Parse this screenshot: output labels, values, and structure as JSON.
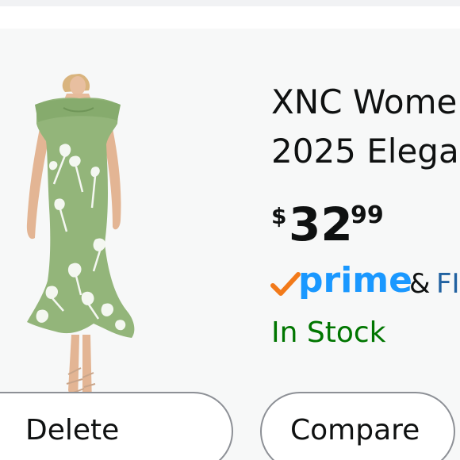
{
  "product": {
    "title_line1": "XNC Women",
    "title_line2": "2025 Elega",
    "price": {
      "symbol": "$",
      "whole": "32",
      "fraction": "99"
    },
    "prime": {
      "label": "prime",
      "ampersand": "&",
      "shipping_fragment": "FI"
    },
    "availability": "In Stock",
    "image_icon": "green-floral-mermaid-dress-photo"
  },
  "actions": {
    "delete_label": "Delete",
    "compare_label": "Compare"
  },
  "colors": {
    "prime_blue": "#1a98ff",
    "prime_check_orange": "#f27a1a",
    "in_stock_green": "#007600",
    "link_blue": "#2162a1",
    "dress_green": "#93b57a"
  }
}
